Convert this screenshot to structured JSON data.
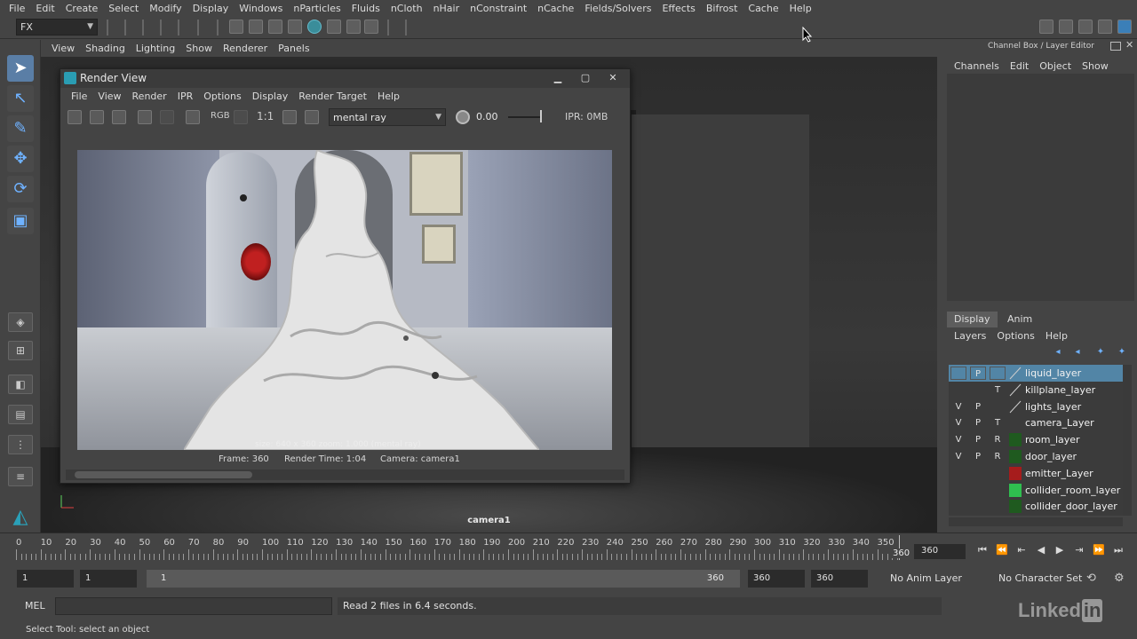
{
  "menubar": [
    "File",
    "Edit",
    "Create",
    "Select",
    "Modify",
    "Display",
    "Windows",
    "nParticles",
    "Fluids",
    "nCloth",
    "nHair",
    "nConstraint",
    "nCache",
    "Fields/Solvers",
    "Effects",
    "Bifrost",
    "Cache",
    "Help"
  ],
  "shelf": {
    "mode": "FX"
  },
  "panel_menus": [
    "View",
    "Shading",
    "Lighting",
    "Show",
    "Renderer",
    "Panels"
  ],
  "viewport": {
    "camera_label": "camera1"
  },
  "render_view": {
    "title": "Render View",
    "menus": [
      "File",
      "View",
      "Render",
      "IPR",
      "Options",
      "Display",
      "Render Target",
      "Help"
    ],
    "rgb_label": "RGB",
    "ratio_label": "1:1",
    "renderer": "mental ray",
    "exposure": "0.00",
    "ipr_memory": "IPR: 0MB",
    "image_overlay": "size: 640 x 360   zoom: 1.000        (mental ray)",
    "status": {
      "frame": "Frame: 360",
      "render_time": "Render Time: 1:04",
      "camera": "Camera: camera1"
    }
  },
  "channel_box": {
    "title": "Channel Box / Layer Editor",
    "menus": [
      "Channels",
      "Edit",
      "Object",
      "Show"
    ]
  },
  "layer_editor": {
    "tabs": [
      "Display",
      "Anim"
    ],
    "menus": [
      "Layers",
      "Options",
      "Help"
    ],
    "layers": [
      {
        "v": "",
        "p": "P",
        "t": "",
        "name": "liquid_layer",
        "color": "none",
        "selected": true
      },
      {
        "v": "",
        "p": "",
        "t": "T",
        "name": "killplane_layer",
        "color": "none",
        "selected": false
      },
      {
        "v": "V",
        "p": "P",
        "t": "",
        "name": "lights_layer",
        "color": "none",
        "selected": false
      },
      {
        "v": "V",
        "p": "P",
        "t": "T",
        "name": "camera_Layer",
        "color": "#3b3b3b",
        "selected": false
      },
      {
        "v": "V",
        "p": "P",
        "t": "R",
        "name": "room_layer",
        "color": "#1f5a1f",
        "selected": false
      },
      {
        "v": "V",
        "p": "P",
        "t": "R",
        "name": "door_layer",
        "color": "#1f5a1f",
        "selected": false
      },
      {
        "v": "",
        "p": "",
        "t": "",
        "name": "emitter_Layer",
        "color": "#a61c1c",
        "selected": false
      },
      {
        "v": "",
        "p": "",
        "t": "",
        "name": "collider_room_layer",
        "color": "#2fbf4f",
        "selected": false
      },
      {
        "v": "",
        "p": "",
        "t": "",
        "name": "collider_door_layer",
        "color": "#1f5a1f",
        "selected": false
      }
    ]
  },
  "timeslider": {
    "ticks": [
      "0",
      "10",
      "20",
      "30",
      "40",
      "50",
      "60",
      "70",
      "80",
      "90",
      "100",
      "110",
      "120",
      "130",
      "140",
      "150",
      "160",
      "170",
      "180",
      "190",
      "200",
      "210",
      "220",
      "230",
      "240",
      "250",
      "260",
      "270",
      "280",
      "290",
      "300",
      "310",
      "320",
      "330",
      "340",
      "350"
    ],
    "current_frame": "360",
    "current_frame_field": "360"
  },
  "range": {
    "start": "1",
    "playback_start": "1",
    "bar_start": "1",
    "bar_end": "360",
    "playback_end": "360",
    "end": "360",
    "anim_layer": "No Anim Layer",
    "character_set": "No Character Set"
  },
  "command": {
    "mel_label": "MEL",
    "result": "Read 2 files in  6.4 seconds."
  },
  "helpline": "Select Tool: select an object",
  "watermark": {
    "text": "Linked",
    "badge": "in"
  }
}
